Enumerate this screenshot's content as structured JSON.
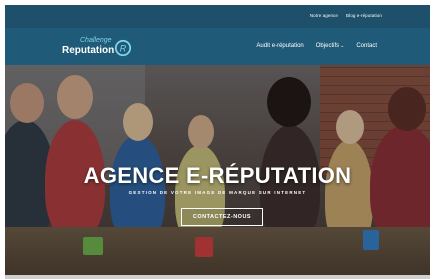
{
  "topbar": {
    "links": [
      "Notre agence",
      "Blog e-réputation"
    ]
  },
  "logo": {
    "line1": "Challenge",
    "line2": "Reputation",
    "mark": "R"
  },
  "menu": {
    "items": [
      "Audit e-réputation",
      "Objectifs",
      "Contact"
    ],
    "dropdown_caret": "⌄"
  },
  "hero": {
    "title": "AGENCE E-RÉPUTATION",
    "subtitle": "GESTION DE VOTRE IMAGE DE MARQUE SUR INTERNET",
    "cta_label": "CONTACTEZ-NOUS"
  },
  "colors": {
    "topbar": "#1e4f6b",
    "navbar": "#1f5a78",
    "logo_accent": "#7fd4e6"
  }
}
